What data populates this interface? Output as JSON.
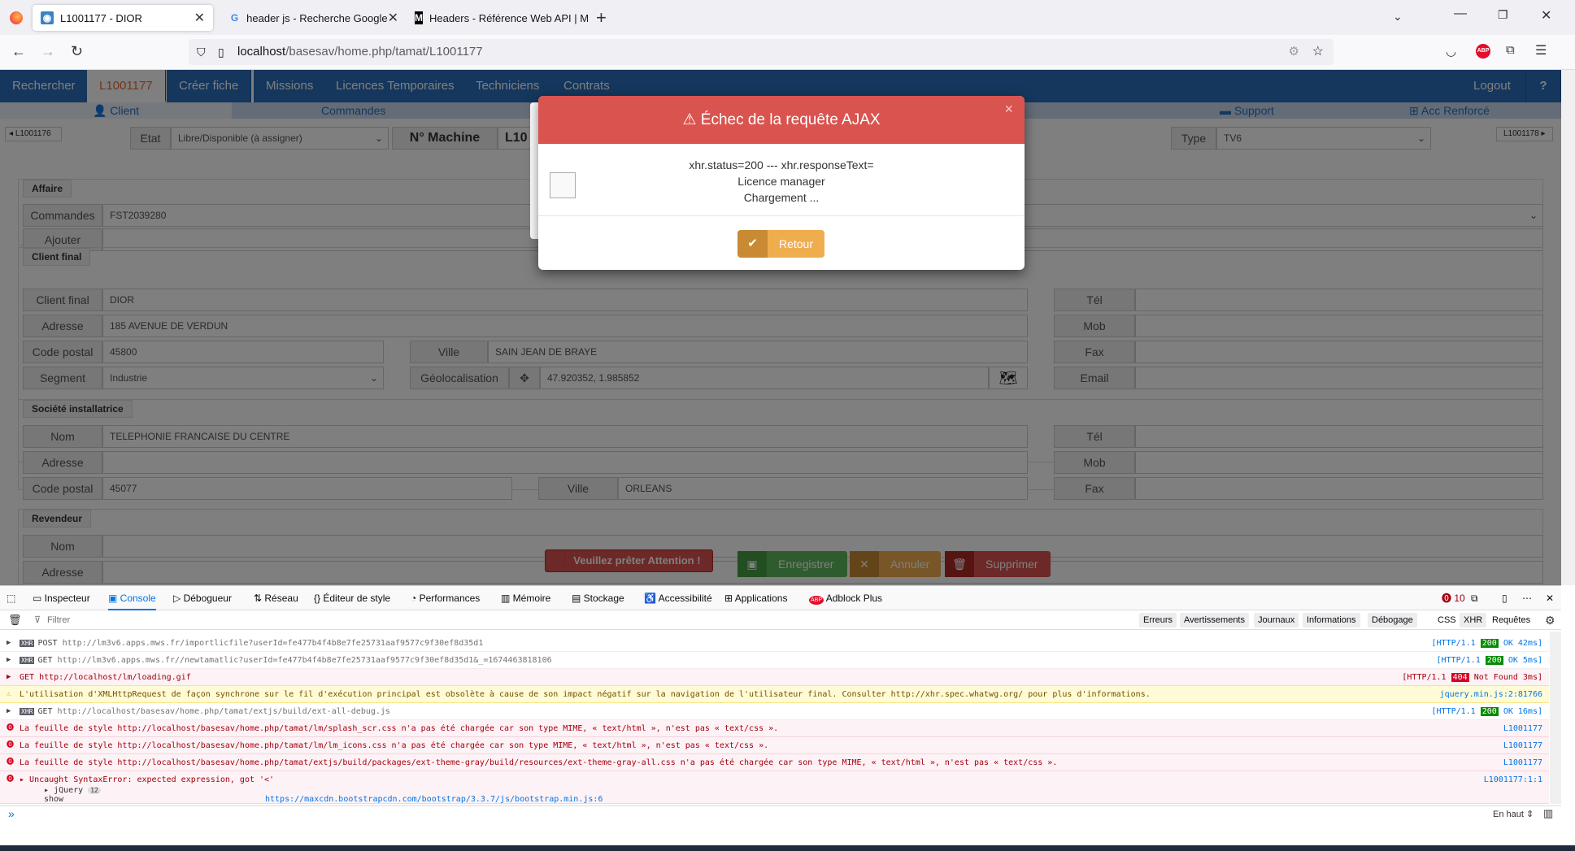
{
  "browser": {
    "tabs": [
      {
        "title": "L1001177 - DIOR",
        "active": true
      },
      {
        "title": "header js - Recherche Google",
        "active": false
      },
      {
        "title": "Headers - Référence Web API | M",
        "active": false
      }
    ],
    "url_host": "localhost",
    "url_path": "/basesav/home.php/tamat/L1001177"
  },
  "app": {
    "menu": [
      "Rechercher",
      "L1001177",
      "Créer fiche",
      "Missions",
      "Licences Temporaires",
      "Techniciens",
      "Contrats"
    ],
    "logout": "Logout",
    "help": "?",
    "subtabs": [
      "Client",
      "Commandes",
      "Support",
      "Acc Renforcé"
    ],
    "prev": "L1001176",
    "next": "L1001178",
    "etat_label": "Etat",
    "etat_value": "Libre/Disponible (à assigner)",
    "machine_label": "N° Machine",
    "machine_value": "L10",
    "type_label": "Type",
    "type_value": "TV6",
    "affaire": {
      "legend": "Affaire",
      "commandes_label": "Commandes",
      "commandes_value": "FST2039280",
      "ajouter_label": "Ajouter"
    },
    "client_final": {
      "legend": "Client final",
      "client_label": "Client final",
      "client_value": "DIOR",
      "adresse_label": "Adresse",
      "adresse_value": "185 AVENUE DE VERDUN",
      "cp_label": "Code postal",
      "cp_value": "45800",
      "ville_label": "Ville",
      "ville_value": "SAIN JEAN DE BRAYE",
      "segment_label": "Segment",
      "segment_value": "Industrie",
      "geo_label": "Géolocalisation",
      "geo_value": "47.920352, 1.985852",
      "tel_label": "Tél",
      "mob_label": "Mob",
      "fax_label": "Fax",
      "email_label": "Email"
    },
    "societe": {
      "legend": "Société installatrice",
      "nom_label": "Nom",
      "nom_value": "TELEPHONIE FRANCAISE DU CENTRE",
      "adresse_label": "Adresse",
      "cp_label": "Code postal",
      "cp_value": "45077",
      "ville_label": "Ville",
      "ville_value": "ORLEANS",
      "tel_label": "Tél",
      "mob_label": "Mob",
      "fax_label": "Fax"
    },
    "revendeur": {
      "legend": "Revendeur",
      "nom_label": "Nom",
      "adresse_label": "Adresse"
    },
    "attention": "Veuillez prêter Attention !",
    "enregistrer": "Enregistrer",
    "annuler": "Annuler",
    "supprimer": "Supprimer"
  },
  "modal": {
    "title": "Échec de la requête AJAX",
    "line1": "xhr.status=200 --- xhr.responseText=",
    "line2": "Licence manager",
    "line3": "Chargement ...",
    "button": "Retour",
    "close": "×"
  },
  "devtools": {
    "tabs": [
      "Inspecteur",
      "Console",
      "Débogueur",
      "Réseau",
      "Éditeur de style",
      "Performances",
      "Mémoire",
      "Stockage",
      "Accessibilité",
      "Applications",
      "Adblock Plus"
    ],
    "error_count": "10",
    "filter_placeholder": "Filtrer",
    "filters": [
      "Erreurs",
      "Avertissements",
      "Journaux",
      "Informations",
      "Débogage",
      "CSS",
      "XHR",
      "Requêtes"
    ],
    "logs": [
      {
        "kind": "xhr",
        "method": "POST",
        "url": "http://lm3v6.apps.mws.fr/importlicfile?userId=fe477b4f4b8e7fe25731aaf9577c9f30ef8d35d1",
        "proto": "[HTTP/1.1",
        "status": "200",
        "result": "OK 42ms]"
      },
      {
        "kind": "xhr",
        "method": "GET",
        "url": "http://lm3v6.apps.mws.fr//newtamatlic?userId=fe477b4f4b8e7fe25731aaf9577c9f30ef8d35d1&_=1674463818106",
        "proto": "[HTTP/1.1",
        "status": "200",
        "result": "OK 5ms]"
      },
      {
        "kind": "err404",
        "method": "GET",
        "url": "http://localhost/lm/loading.gif",
        "proto": "[HTTP/1.1",
        "status": "404",
        "result": "Not Found 3ms]"
      },
      {
        "kind": "warn",
        "text": "L'utilisation d'XMLHttpRequest de façon synchrone sur le fil d'exécution principal est obsolète à cause de son impact négatif sur la navigation de l'utilisateur final. Consulter http://xhr.spec.whatwg.org/ pour plus d'informations.",
        "src": "jquery.min.js:2:81766"
      },
      {
        "kind": "xhr",
        "method": "GET",
        "url": "http://localhost/basesav/home.php/tamat/extjs/build/ext-all-debug.js",
        "proto": "[HTTP/1.1",
        "status": "200",
        "result": "OK 16ms]"
      },
      {
        "kind": "err",
        "text": "La feuille de style http://localhost/basesav/home.php/tamat/lm/splash_scr.css n'a pas été chargée car son type MIME, « text/html », n'est pas « text/css ».",
        "src": "L1001177"
      },
      {
        "kind": "err",
        "text": "La feuille de style http://localhost/basesav/home.php/tamat/lm/lm_icons.css n'a pas été chargée car son type MIME, « text/html », n'est pas « text/css ».",
        "src": "L1001177"
      },
      {
        "kind": "err",
        "text": "La feuille de style http://localhost/basesav/home.php/tamat/extjs/build/packages/ext-theme-gray/build/resources/ext-theme-gray-all.css n'a pas été chargée car son type MIME, « text/html », n'est pas « text/css ».",
        "src": "L1001177"
      },
      {
        "kind": "err",
        "text": "Uncaught SyntaxError: expected expression, got '<'",
        "src": "L1001177:1:1"
      }
    ],
    "trace1": "jQuery",
    "trace1_count": "12",
    "trace2": "show",
    "trace2_src": "https://maxcdn.bootstrapcdn.com/bootstrap/3.3.7/js/bootstrap.min.js:6",
    "prompt": "»",
    "en_haut": "En haut"
  }
}
